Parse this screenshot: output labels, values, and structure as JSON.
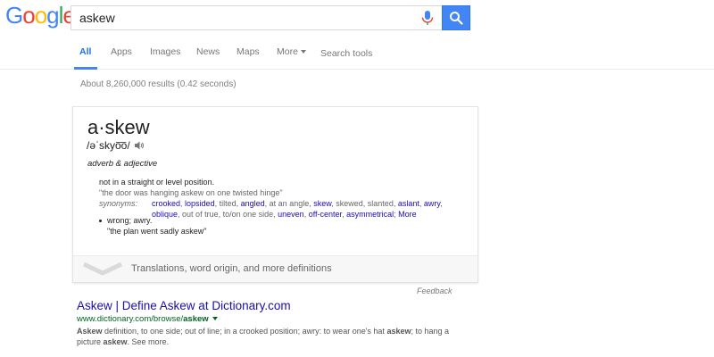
{
  "header": {
    "logo_letters": [
      {
        "ch": "G",
        "color": "#4285f4"
      },
      {
        "ch": "o",
        "color": "#ea4335"
      },
      {
        "ch": "o",
        "color": "#fbbc05"
      },
      {
        "ch": "g",
        "color": "#4285f4"
      },
      {
        "ch": "l",
        "color": "#34a853"
      },
      {
        "ch": "e",
        "color": "#ea4335"
      }
    ],
    "query": "askew",
    "mic_icon": "microphone-icon",
    "search_icon": "magnifier-icon"
  },
  "tabs": {
    "all": "All",
    "apps": "Apps",
    "images": "Images",
    "news": "News",
    "maps": "Maps",
    "more": "More",
    "search_tools": "Search tools"
  },
  "result_stats": "About 8,260,000 results (0.42 seconds)",
  "dictionary": {
    "word": "a·skew",
    "pronunciation": "/əˈskyo͞o/",
    "part_of_speech": "adverb & adjective",
    "sense1": {
      "definition": "not in a straight or level position.",
      "example": "\"the door was hanging askew on one twisted hinge\"",
      "synonyms_label": "synonyms:",
      "synonyms": [
        {
          "text": "crooked",
          "link": true
        },
        {
          "text": "lopsided",
          "link": true
        },
        {
          "text": "tilted",
          "link": false
        },
        {
          "text": "angled",
          "link": true
        },
        {
          "text": "at an angle",
          "link": false
        },
        {
          "text": "skew",
          "link": true
        },
        {
          "text": "skewed",
          "link": false
        },
        {
          "text": "slanted",
          "link": false
        },
        {
          "text": "aslant",
          "link": true
        },
        {
          "text": "awry",
          "link": true
        },
        {
          "text": "oblique",
          "link": true
        },
        {
          "text": "out of true",
          "link": false
        },
        {
          "text": "to/on one side",
          "link": false
        },
        {
          "text": "uneven",
          "link": true
        },
        {
          "text": "off-center",
          "link": true
        },
        {
          "text": "asymmetrical",
          "link": true
        }
      ],
      "more_label": "More"
    },
    "sense2": {
      "definition": "wrong; awry.",
      "example": "\"the plan went sadly askew\""
    },
    "more_definitions": "Translations, word origin, and more definitions"
  },
  "feedback": "Feedback",
  "result": {
    "title": "Askew | Define Askew at Dictionary.com",
    "url_prefix": "www.dictionary.com/browse/",
    "url_bold": "askew",
    "snippet_parts": [
      {
        "text": "Askew",
        "bold": true
      },
      {
        "text": " definition, to one side; out of line; in a crooked position; awry: to wear one's hat ",
        "bold": false
      },
      {
        "text": "askew",
        "bold": true
      },
      {
        "text": "; to hang a picture ",
        "bold": false
      },
      {
        "text": "askew",
        "bold": true
      },
      {
        "text": ". See more.",
        "bold": false
      }
    ]
  },
  "colors": {
    "link": "#1a0dab",
    "url_green": "#006621",
    "active_tab": "#4285f4",
    "search_button": "#4285f4"
  }
}
